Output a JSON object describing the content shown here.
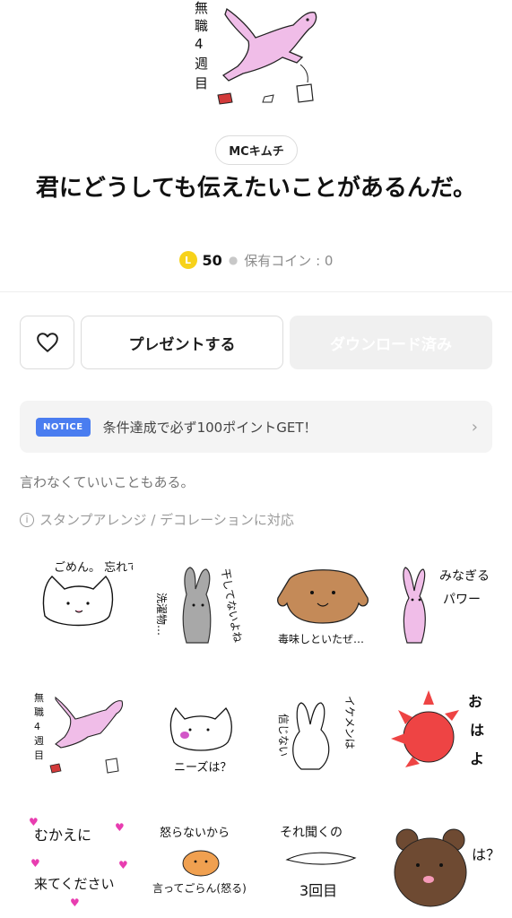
{
  "hero": {
    "label": "無職4週目"
  },
  "author": {
    "name": "MCキムチ"
  },
  "product": {
    "title": "君にどうしても伝えたいことがあるんだ。"
  },
  "price": {
    "coin_badge": "L",
    "amount": "50",
    "owned_label": "保有コイン : 0"
  },
  "actions": {
    "like_icon": "heart-icon",
    "present_label": "プレゼントする",
    "download_label": "ダウンロード済み"
  },
  "notice": {
    "badge": "NOTICE",
    "text": "条件達成で必ず100ポイントGET！"
  },
  "description": "言わなくていいこともある。",
  "feature": {
    "icon": "info-icon",
    "text": "スタンプアレンジ / デコレーションに対応"
  },
  "stickers": [
    {
      "text": "ごめん。 忘れてた"
    },
    {
      "text": "干してないよね 洗濯物…"
    },
    {
      "text": "毒味しといたぜ…"
    },
    {
      "text": "みなぎるパワー"
    },
    {
      "text": "無職4週目"
    },
    {
      "text": "ニーズは？"
    },
    {
      "text": "信じない イケメンは"
    },
    {
      "text": "おはよ"
    },
    {
      "text": "むかえに来てください"
    },
    {
      "text": "怒らないから言ってごらん(怒る)"
    },
    {
      "text": "それ聞くの3回目"
    },
    {
      "text": "は？"
    }
  ],
  "colors": {
    "accent_blue": "#4a7df0",
    "coin_yellow": "#f7d21a",
    "sticker_pink": "#f0bde8"
  }
}
